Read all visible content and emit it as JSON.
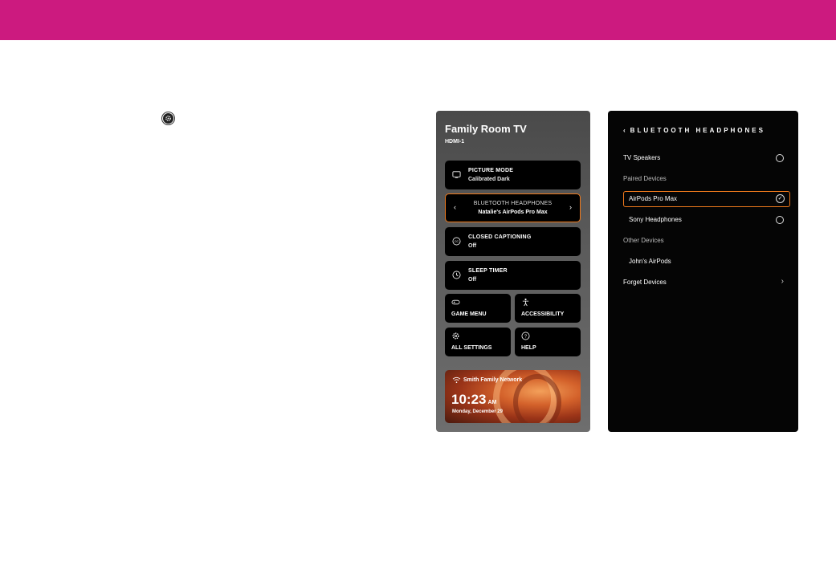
{
  "left_panel": {
    "title": "Family Room TV",
    "input": "HDMI-1",
    "picture_mode": {
      "label": "PICTURE MODE",
      "value": "Calibrated Dark"
    },
    "bluetooth": {
      "label": "BLUETOOTH HEADPHONES",
      "value": "Natalie's AirPods Pro Max"
    },
    "closed_captioning": {
      "label": "CLOSED CAPTIONING",
      "value": "Off"
    },
    "sleep_timer": {
      "label": "SLEEP TIMER",
      "value": "Off"
    },
    "game_menu": "GAME MENU",
    "accessibility": "ACCESSIBILITY",
    "all_settings": "ALL SETTINGS",
    "help": "HELP",
    "network": {
      "name": "Smith Family Network",
      "time": "10:23",
      "ampm": "AM",
      "date": "Monday, December 29"
    }
  },
  "right_panel": {
    "header": "BLUETOOTH HEADPHONES",
    "tv_speakers": "TV Speakers",
    "paired_section": "Paired Devices",
    "paired": [
      "AirPods Pro Max",
      "Sony Headphones"
    ],
    "other_section": "Other Devices",
    "other": [
      "John's AirPods"
    ],
    "forget": "Forget Devices"
  },
  "colors": {
    "brand_bar": "#cc1a7f",
    "selection": "#f07a1c"
  },
  "icons": [
    "settings-icon",
    "monitor-icon",
    "closed-caption-icon",
    "clock-icon",
    "gamepad-icon",
    "accessibility-icon",
    "gear-icon",
    "help-icon",
    "wifi-icon",
    "back-chevron-icon",
    "chevron-right-icon",
    "check-icon"
  ]
}
